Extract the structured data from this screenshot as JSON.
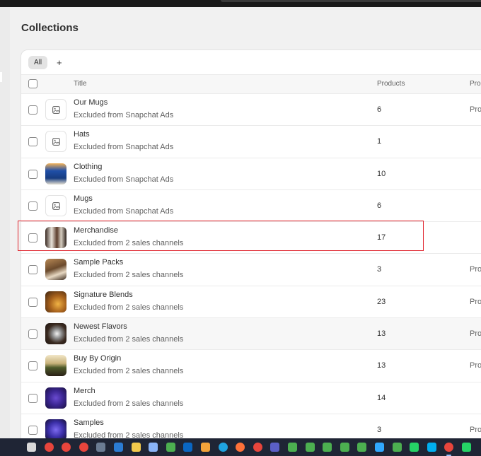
{
  "page": {
    "title": "Collections"
  },
  "tabs": {
    "all_label": "All",
    "add_label": "+"
  },
  "table": {
    "columns": {
      "title": "Title",
      "products": "Products",
      "third": "Prod"
    },
    "rows": [
      {
        "title": "Our Mugs",
        "subtitle": "Excluded from Snapchat Ads",
        "products": "6",
        "third": "Pro",
        "thumb": "placeholder-image-icon"
      },
      {
        "title": "Hats",
        "subtitle": "Excluded from Snapchat Ads",
        "products": "1",
        "third": "",
        "thumb": "placeholder-image-icon"
      },
      {
        "title": "Clothing",
        "subtitle": "Excluded from Snapchat Ads",
        "products": "10",
        "third": "",
        "thumb": "clothing-photo"
      },
      {
        "title": "Mugs",
        "subtitle": "Excluded from Snapchat Ads",
        "products": "6",
        "third": "",
        "thumb": "placeholder-image-icon"
      },
      {
        "title": "Merchandise",
        "subtitle": "Excluded from 2 sales channels",
        "products": "17",
        "third": "",
        "thumb": "merchandise-photo"
      },
      {
        "title": "Sample Packs",
        "subtitle": "Excluded from 2 sales channels",
        "products": "3",
        "third": "Pro",
        "thumb": "sample-packs-photo"
      },
      {
        "title": "Signature Blends",
        "subtitle": "Excluded from 2 sales channels",
        "products": "23",
        "third": "Pro",
        "thumb": "signature-blends-photo"
      },
      {
        "title": "Newest Flavors",
        "subtitle": "Excluded from 2 sales channels",
        "products": "13",
        "third": "Pro",
        "thumb": "newest-flavors-photo"
      },
      {
        "title": "Buy By Origin",
        "subtitle": "Excluded from 2 sales channels",
        "products": "13",
        "third": "Pro",
        "thumb": "buy-by-origin-photo"
      },
      {
        "title": "Merch",
        "subtitle": "Excluded from 2 sales channels",
        "products": "14",
        "third": "",
        "thumb": "merch-graphic"
      },
      {
        "title": "Samples",
        "subtitle": "Excluded from 2 sales channels",
        "products": "3",
        "third": "Pro",
        "thumb": "samples-graphic"
      }
    ]
  },
  "highlight_color": "#e0232c",
  "taskbar": {
    "icons": [
      "task-view-icon",
      "chrome-icon",
      "chrome-icon",
      "chrome-icon",
      "calculator-icon",
      "mail-icon",
      "file-explorer-icon",
      "notepad-icon",
      "app-icon",
      "linkedin-icon",
      "medal-icon",
      "edge-icon",
      "firefox-icon",
      "chrome-icon",
      "teams-icon",
      "app-icon",
      "app-icon",
      "app-icon",
      "app-icon",
      "app-icon",
      "photoshop-icon",
      "app-icon",
      "whatsapp-icon",
      "skype-icon",
      "chrome-icon",
      "whatsapp-icon"
    ]
  }
}
